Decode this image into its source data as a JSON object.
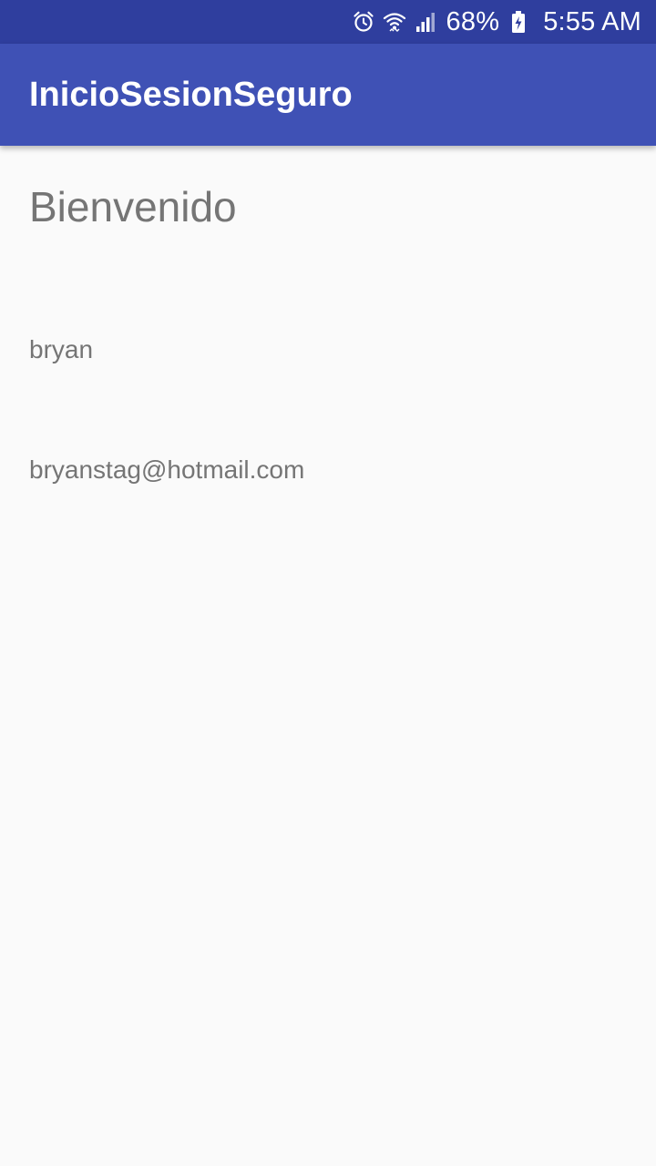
{
  "status_bar": {
    "battery_percent": "68%",
    "time": "5:55 AM",
    "icons": [
      "alarm-icon",
      "wifi-icon",
      "cell-signal-icon",
      "battery-charging-icon"
    ],
    "background_color": "#2f3e9e"
  },
  "app_bar": {
    "title": "InicioSesionSeguro",
    "background_color": "#3f51b5"
  },
  "main": {
    "welcome_text": "Bienvenido",
    "username": "bryan",
    "email": "bryanstag@hotmail.com",
    "text_color": "#757575",
    "background_color": "#fafafa"
  }
}
